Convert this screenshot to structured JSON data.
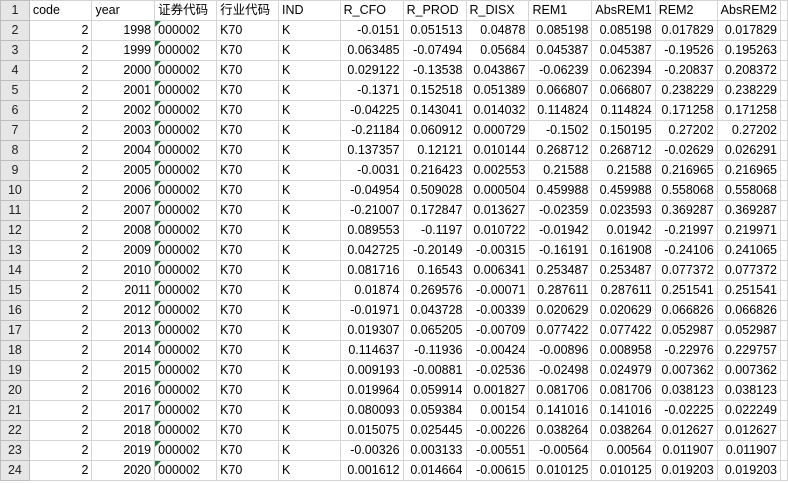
{
  "columns": [
    "code",
    "year",
    "证券代码",
    "行业代码",
    "IND",
    "R_CFO",
    "R_PROD",
    "R_DISX",
    "REM1",
    "AbsREM1",
    "REM2",
    "AbsREM2"
  ],
  "header_row_number": "1",
  "rows": [
    {
      "n": "2",
      "code": "2",
      "year": "1998",
      "sec": "000002",
      "ind_code": "K70",
      "ind": "K",
      "r_cfo": "-0.0151",
      "r_prod": "0.051513",
      "r_disx": "0.04878",
      "rem1": "0.085198",
      "absrem1": "0.085198",
      "rem2": "0.017829",
      "absrem2": "0.017829"
    },
    {
      "n": "3",
      "code": "2",
      "year": "1999",
      "sec": "000002",
      "ind_code": "K70",
      "ind": "K",
      "r_cfo": "0.063485",
      "r_prod": "-0.07494",
      "r_disx": "0.05684",
      "rem1": "0.045387",
      "absrem1": "0.045387",
      "rem2": "-0.19526",
      "absrem2": "0.195263"
    },
    {
      "n": "4",
      "code": "2",
      "year": "2000",
      "sec": "000002",
      "ind_code": "K70",
      "ind": "K",
      "r_cfo": "0.029122",
      "r_prod": "-0.13538",
      "r_disx": "0.043867",
      "rem1": "-0.06239",
      "absrem1": "0.062394",
      "rem2": "-0.20837",
      "absrem2": "0.208372"
    },
    {
      "n": "5",
      "code": "2",
      "year": "2001",
      "sec": "000002",
      "ind_code": "K70",
      "ind": "K",
      "r_cfo": "-0.1371",
      "r_prod": "0.152518",
      "r_disx": "0.051389",
      "rem1": "0.066807",
      "absrem1": "0.066807",
      "rem2": "0.238229",
      "absrem2": "0.238229"
    },
    {
      "n": "6",
      "code": "2",
      "year": "2002",
      "sec": "000002",
      "ind_code": "K70",
      "ind": "K",
      "r_cfo": "-0.04225",
      "r_prod": "0.143041",
      "r_disx": "0.014032",
      "rem1": "0.114824",
      "absrem1": "0.114824",
      "rem2": "0.171258",
      "absrem2": "0.171258"
    },
    {
      "n": "7",
      "code": "2",
      "year": "2003",
      "sec": "000002",
      "ind_code": "K70",
      "ind": "K",
      "r_cfo": "-0.21184",
      "r_prod": "0.060912",
      "r_disx": "0.000729",
      "rem1": "-0.1502",
      "absrem1": "0.150195",
      "rem2": "0.27202",
      "absrem2": "0.27202"
    },
    {
      "n": "8",
      "code": "2",
      "year": "2004",
      "sec": "000002",
      "ind_code": "K70",
      "ind": "K",
      "r_cfo": "0.137357",
      "r_prod": "0.12121",
      "r_disx": "0.010144",
      "rem1": "0.268712",
      "absrem1": "0.268712",
      "rem2": "-0.02629",
      "absrem2": "0.026291"
    },
    {
      "n": "9",
      "code": "2",
      "year": "2005",
      "sec": "000002",
      "ind_code": "K70",
      "ind": "K",
      "r_cfo": "-0.0031",
      "r_prod": "0.216423",
      "r_disx": "0.002553",
      "rem1": "0.21588",
      "absrem1": "0.21588",
      "rem2": "0.216965",
      "absrem2": "0.216965"
    },
    {
      "n": "10",
      "code": "2",
      "year": "2006",
      "sec": "000002",
      "ind_code": "K70",
      "ind": "K",
      "r_cfo": "-0.04954",
      "r_prod": "0.509028",
      "r_disx": "0.000504",
      "rem1": "0.459988",
      "absrem1": "0.459988",
      "rem2": "0.558068",
      "absrem2": "0.558068"
    },
    {
      "n": "11",
      "code": "2",
      "year": "2007",
      "sec": "000002",
      "ind_code": "K70",
      "ind": "K",
      "r_cfo": "-0.21007",
      "r_prod": "0.172847",
      "r_disx": "0.013627",
      "rem1": "-0.02359",
      "absrem1": "0.023593",
      "rem2": "0.369287",
      "absrem2": "0.369287"
    },
    {
      "n": "12",
      "code": "2",
      "year": "2008",
      "sec": "000002",
      "ind_code": "K70",
      "ind": "K",
      "r_cfo": "0.089553",
      "r_prod": "-0.1197",
      "r_disx": "0.010722",
      "rem1": "-0.01942",
      "absrem1": "0.01942",
      "rem2": "-0.21997",
      "absrem2": "0.219971"
    },
    {
      "n": "13",
      "code": "2",
      "year": "2009",
      "sec": "000002",
      "ind_code": "K70",
      "ind": "K",
      "r_cfo": "0.042725",
      "r_prod": "-0.20149",
      "r_disx": "-0.00315",
      "rem1": "-0.16191",
      "absrem1": "0.161908",
      "rem2": "-0.24106",
      "absrem2": "0.241065"
    },
    {
      "n": "14",
      "code": "2",
      "year": "2010",
      "sec": "000002",
      "ind_code": "K70",
      "ind": "K",
      "r_cfo": "0.081716",
      "r_prod": "0.16543",
      "r_disx": "0.006341",
      "rem1": "0.253487",
      "absrem1": "0.253487",
      "rem2": "0.077372",
      "absrem2": "0.077372"
    },
    {
      "n": "15",
      "code": "2",
      "year": "2011",
      "sec": "000002",
      "ind_code": "K70",
      "ind": "K",
      "r_cfo": "0.01874",
      "r_prod": "0.269576",
      "r_disx": "-0.00071",
      "rem1": "0.287611",
      "absrem1": "0.287611",
      "rem2": "0.251541",
      "absrem2": "0.251541"
    },
    {
      "n": "16",
      "code": "2",
      "year": "2012",
      "sec": "000002",
      "ind_code": "K70",
      "ind": "K",
      "r_cfo": "-0.01971",
      "r_prod": "0.043728",
      "r_disx": "-0.00339",
      "rem1": "0.020629",
      "absrem1": "0.020629",
      "rem2": "0.066826",
      "absrem2": "0.066826"
    },
    {
      "n": "17",
      "code": "2",
      "year": "2013",
      "sec": "000002",
      "ind_code": "K70",
      "ind": "K",
      "r_cfo": "0.019307",
      "r_prod": "0.065205",
      "r_disx": "-0.00709",
      "rem1": "0.077422",
      "absrem1": "0.077422",
      "rem2": "0.052987",
      "absrem2": "0.052987"
    },
    {
      "n": "18",
      "code": "2",
      "year": "2014",
      "sec": "000002",
      "ind_code": "K70",
      "ind": "K",
      "r_cfo": "0.114637",
      "r_prod": "-0.11936",
      "r_disx": "-0.00424",
      "rem1": "-0.00896",
      "absrem1": "0.008958",
      "rem2": "-0.22976",
      "absrem2": "0.229757"
    },
    {
      "n": "19",
      "code": "2",
      "year": "2015",
      "sec": "000002",
      "ind_code": "K70",
      "ind": "K",
      "r_cfo": "0.009193",
      "r_prod": "-0.00881",
      "r_disx": "-0.02536",
      "rem1": "-0.02498",
      "absrem1": "0.024979",
      "rem2": "0.007362",
      "absrem2": "0.007362"
    },
    {
      "n": "20",
      "code": "2",
      "year": "2016",
      "sec": "000002",
      "ind_code": "K70",
      "ind": "K",
      "r_cfo": "0.019964",
      "r_prod": "0.059914",
      "r_disx": "0.001827",
      "rem1": "0.081706",
      "absrem1": "0.081706",
      "rem2": "0.038123",
      "absrem2": "0.038123"
    },
    {
      "n": "21",
      "code": "2",
      "year": "2017",
      "sec": "000002",
      "ind_code": "K70",
      "ind": "K",
      "r_cfo": "0.080093",
      "r_prod": "0.059384",
      "r_disx": "0.00154",
      "rem1": "0.141016",
      "absrem1": "0.141016",
      "rem2": "-0.02225",
      "absrem2": "0.022249"
    },
    {
      "n": "22",
      "code": "2",
      "year": "2018",
      "sec": "000002",
      "ind_code": "K70",
      "ind": "K",
      "r_cfo": "0.015075",
      "r_prod": "0.025445",
      "r_disx": "-0.00226",
      "rem1": "0.038264",
      "absrem1": "0.038264",
      "rem2": "0.012627",
      "absrem2": "0.012627"
    },
    {
      "n": "23",
      "code": "2",
      "year": "2019",
      "sec": "000002",
      "ind_code": "K70",
      "ind": "K",
      "r_cfo": "-0.00326",
      "r_prod": "0.003133",
      "r_disx": "-0.00551",
      "rem1": "-0.00564",
      "absrem1": "0.00564",
      "rem2": "0.011907",
      "absrem2": "0.011907"
    },
    {
      "n": "24",
      "code": "2",
      "year": "2020",
      "sec": "000002",
      "ind_code": "K70",
      "ind": "K",
      "r_cfo": "0.001612",
      "r_prod": "0.014664",
      "r_disx": "-0.00615",
      "rem1": "0.010125",
      "absrem1": "0.010125",
      "rem2": "0.019203",
      "absrem2": "0.019203"
    }
  ]
}
